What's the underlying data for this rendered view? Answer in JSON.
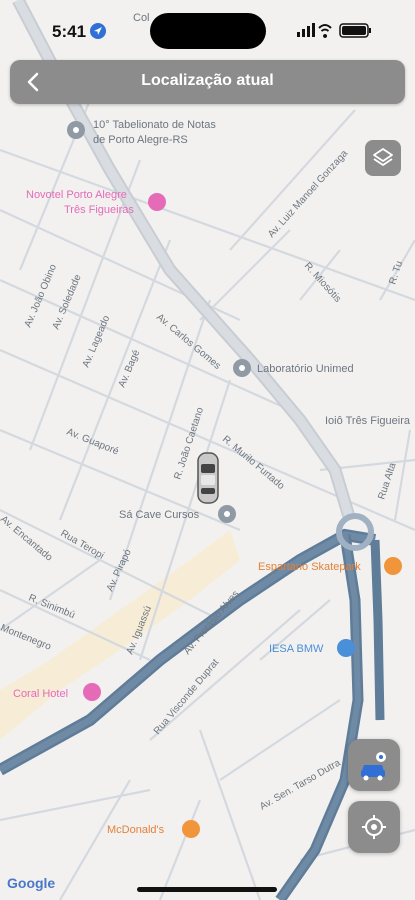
{
  "status_bar": {
    "time": "5:41"
  },
  "header": {
    "title": "Localização atual"
  },
  "map": {
    "pois": [
      {
        "label1": "10° Tabelionato de Notas",
        "label2": "de Porto Alegre-RS"
      },
      {
        "label1": "Novotel Porto Alegre",
        "label2": "Três Figueiras"
      },
      {
        "label": "Laboratório Unimed"
      },
      {
        "label": "Sá Cave Cursos"
      },
      {
        "label": "Espartano Skatepark"
      },
      {
        "label": "IESA BMW"
      },
      {
        "label": "Coral Hotel"
      },
      {
        "label": "McDonald's"
      },
      {
        "label": "Ioiô Três Figueira"
      }
    ],
    "streets": [
      "Av. João Obino",
      "Av. Soledade",
      "Av. Lageado",
      "Av. Bagé",
      "Av. Carlos Gomes",
      "Av. Luiz Manoel Gonzaga",
      "R. Miosótis",
      "R. João Caetano",
      "R. Murilo Furtado",
      "Av. Guaporé",
      "Av. Encantado",
      "Rua Teropi",
      "Av. Pirapó",
      "R. Sinimbú",
      "Av. Iguassú",
      "Av. Protásio Alves",
      "Rua Visconde Duprat",
      "Av. Sen. Tarso Dutra",
      "Rua Alta",
      "Montenegro",
      "R. Tu"
    ],
    "top_partial": "Col",
    "attribution": "Google"
  },
  "colors": {
    "control_bg": "#8c8c8c",
    "route": "#5f7c99",
    "car": "#c9c9c9"
  }
}
